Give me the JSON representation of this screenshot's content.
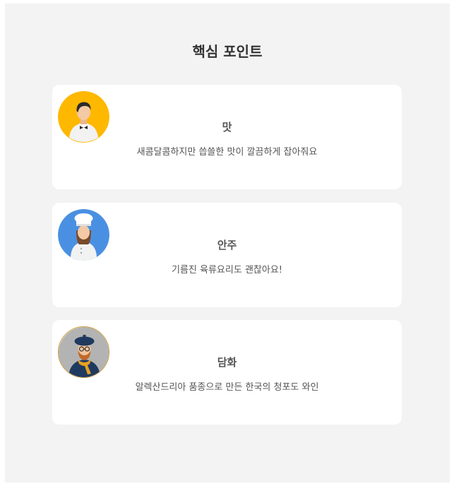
{
  "section": {
    "title": "핵심 포인트"
  },
  "cards": [
    {
      "title": "맛",
      "description": "새콤달콤하지만 씁쓸한 맛이 깔끔하게 잡아줘요",
      "icon": "waiter-avatar-icon",
      "icon_bg": "#ffb800"
    },
    {
      "title": "안주",
      "description": "기름진 육류요리도 괜찮아요!",
      "icon": "chef-avatar-icon",
      "icon_bg": "#4a90e2"
    },
    {
      "title": "담화",
      "description": "알렉산드리아 품종으로 만든 한국의 청포도 와인",
      "icon": "artist-avatar-icon",
      "icon_bg": "#b3b3b3"
    }
  ]
}
